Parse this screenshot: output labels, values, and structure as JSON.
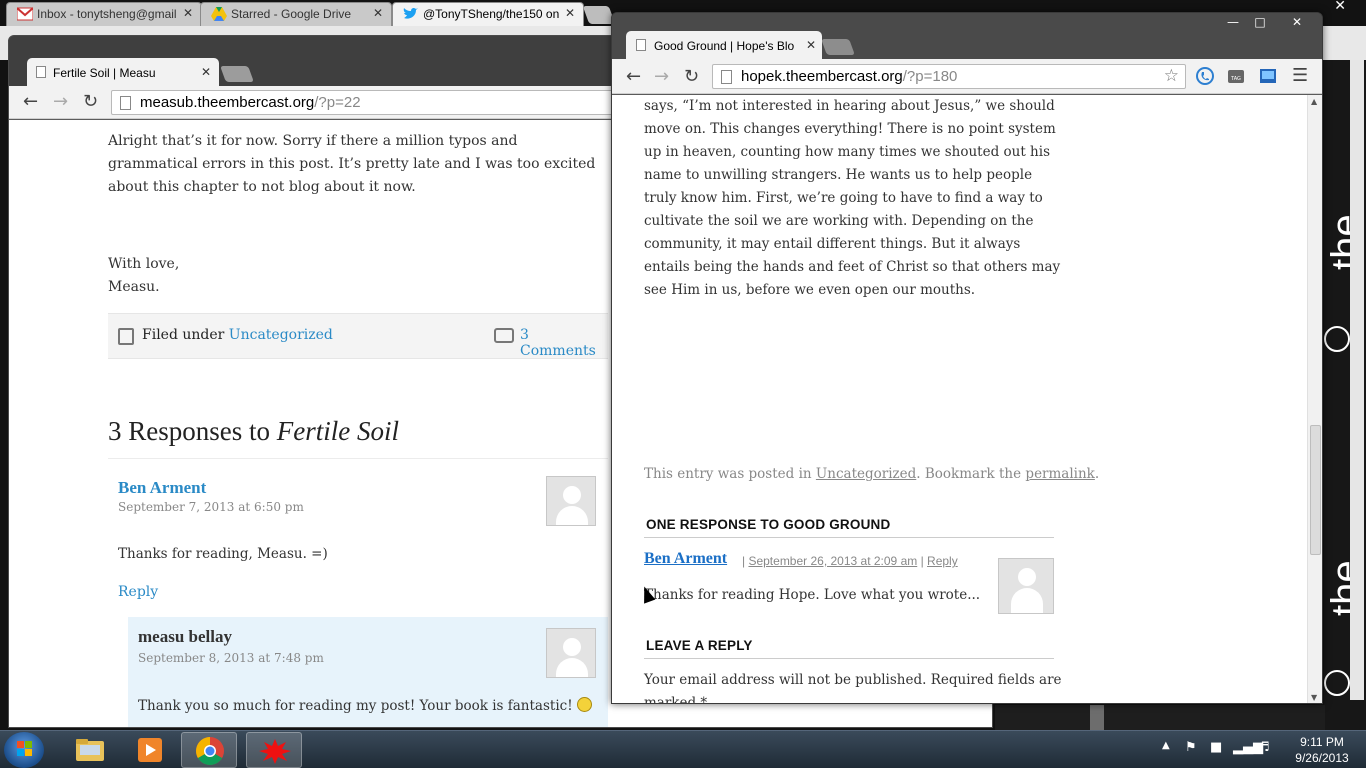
{
  "background_browser": {
    "tabs": [
      {
        "title": "Inbox - tonytsheng@gmail",
        "icon": "gmail-icon"
      },
      {
        "title": "Starred - Google Drive",
        "icon": "drive-icon"
      },
      {
        "title": "@TonyTSheng/the150 on",
        "icon": "twitter-icon"
      }
    ]
  },
  "left_window": {
    "tab_title": "Fertile Soil | Measu",
    "url_host": "measub.theembercast.org",
    "url_path": "/?p=22",
    "post_text": "Alright that’s it for now. Sorry if there a million typos and grammatical errors in this post. It’s pretty late and I was too excited about this chapter to not blog about it now.",
    "signoff_1": "With love,",
    "signoff_2": "Measu.",
    "filed_label": "Filed under",
    "filed_category": "Uncategorized",
    "comments_link": "3 Comments",
    "responses_heading": "3 Responses to",
    "responses_title": "Fertile Soil",
    "comments": [
      {
        "author": "Ben Arment",
        "date": "September 7, 2013 at 6:50 pm",
        "text": "Thanks for reading, Measu. =)",
        "reply": "Reply"
      }
    ],
    "nested_reply": {
      "author": "measu bellay",
      "date": "September 8, 2013 at 7:48 pm",
      "text": "Thank you so much for reading my post! Your book is fantastic!"
    }
  },
  "front_window": {
    "tab_title": "Good Ground | Hope's Blo",
    "url_host": "hopek.theembercast.org",
    "url_path": "/?p=180",
    "post_text": "says, “I’m not interested in hearing about Jesus,” we should move on. This changes everything! There is no point system up in heaven, counting how many times we shouted out his name to unwilling strangers. He wants us to help people truly know him. First, we’re going to have to find a way to cultivate the soil we are working with. Depending on the community, it may entail different things. But it always entails being the hands and feet of Christ so that others may see Him in us, before we even open our mouths.",
    "posted_prefix": "This entry was posted in",
    "posted_category": "Uncategorized",
    "posted_middle": ". Bookmark the",
    "posted_permalink": "permalink",
    "posted_end": ".",
    "responses_heading": "ONE RESPONSE TO GOOD GROUND",
    "comment": {
      "author": "Ben Arment",
      "date": "September 26, 2013 at 2:09 am",
      "reply": "Reply",
      "text": "Thanks for reading Hope. Love what you wrote..."
    },
    "leave_reply_heading": "LEAVE A REPLY",
    "email_note": "Your email address will not be published. Required fields are marked *"
  },
  "taskbar": {
    "apps": [
      "explorer",
      "media-player",
      "chrome",
      "paint"
    ],
    "time": "9:11 PM",
    "date": "9/26/2013"
  },
  "background_right": {
    "logo_text": "the"
  },
  "colors": {
    "link": "#2a8ac6",
    "comment_link": "#1b6fc6",
    "reply_bg": "#e7f3fb"
  }
}
